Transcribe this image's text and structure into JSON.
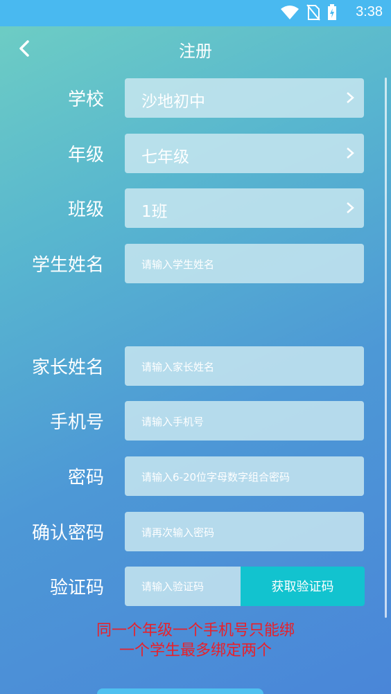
{
  "status": {
    "time": "3:38"
  },
  "nav": {
    "title": "注册"
  },
  "form": {
    "school": {
      "label": "学校",
      "value": "沙地初中"
    },
    "grade": {
      "label": "年级",
      "value": "七年级"
    },
    "class": {
      "label": "班级",
      "value": "1班"
    },
    "student_name": {
      "label": "学生姓名",
      "placeholder": "请输入学生姓名"
    },
    "parent_name": {
      "label": "家长姓名",
      "placeholder": "请输入家长姓名"
    },
    "phone": {
      "label": "手机号",
      "placeholder": "请输入手机号"
    },
    "password": {
      "label": "密码",
      "placeholder": "请输入6-20位字母数字组合密码"
    },
    "confirm_password": {
      "label": "确认密码",
      "placeholder": "请再次输入密码"
    },
    "verify_code": {
      "label": "验证码",
      "placeholder": "请输入验证码",
      "button": "获取验证码"
    }
  },
  "hint": {
    "line1": "同一个年级一个手机号只能绑",
    "line2": "一个学生最多绑定两个"
  },
  "colors": {
    "status_bar": "#49b9f0",
    "accent_button": "#12c3cf",
    "hint_text": "#e8202a"
  }
}
